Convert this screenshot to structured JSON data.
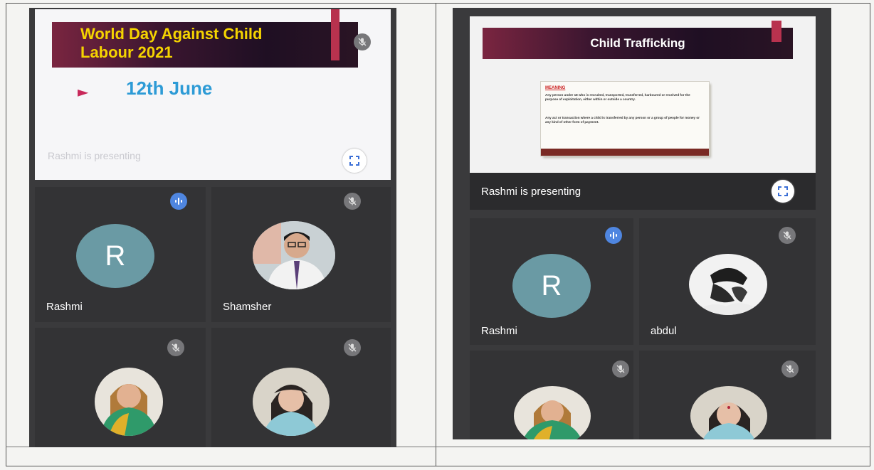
{
  "left": {
    "slide": {
      "title": "World Day Against Child Labour 2021",
      "bullet": "►",
      "date": "12th June",
      "presenting_overlay": "Rashmi is presenting"
    },
    "tiles": [
      {
        "label": "Rashmi",
        "initial": "R",
        "status": "speaking"
      },
      {
        "label": "Shamsher",
        "status": "muted"
      },
      {
        "label": "",
        "status": "muted"
      },
      {
        "label": "",
        "status": "muted"
      }
    ]
  },
  "right": {
    "slide": {
      "title": "Child Trafficking",
      "meaning_heading": "MEANING",
      "meaning_para1": "Any person under 18 who is recruited, transported, transferred, harboured or received for the purpose of exploitation, either within or outside a country.",
      "meaning_para2": "Any act or transaction where a child is transferred by any person or a group of people for money or any kind of other form of payment."
    },
    "presenting": "Rashmi is presenting",
    "tiles": [
      {
        "label": "Rashmi",
        "initial": "R",
        "status": "speaking"
      },
      {
        "label": "abdul",
        "status": "muted"
      },
      {
        "label": "",
        "status": "muted"
      },
      {
        "label": "",
        "status": "muted"
      }
    ]
  },
  "colors": {
    "meeting_bg": "#3a3a3c",
    "tile_bg": "#333335",
    "avatar_teal": "#6a9aa4",
    "speaking_blue": "#4f86e0",
    "title_yellow": "#f5d400",
    "date_blue": "#2d9bd6",
    "bullet_pink": "#c8285a",
    "accent_crimson": "#b8324e"
  },
  "icons": {
    "mute": "mic-off-icon",
    "speaking": "audio-level-icon",
    "fullscreen": "fullscreen-icon"
  }
}
